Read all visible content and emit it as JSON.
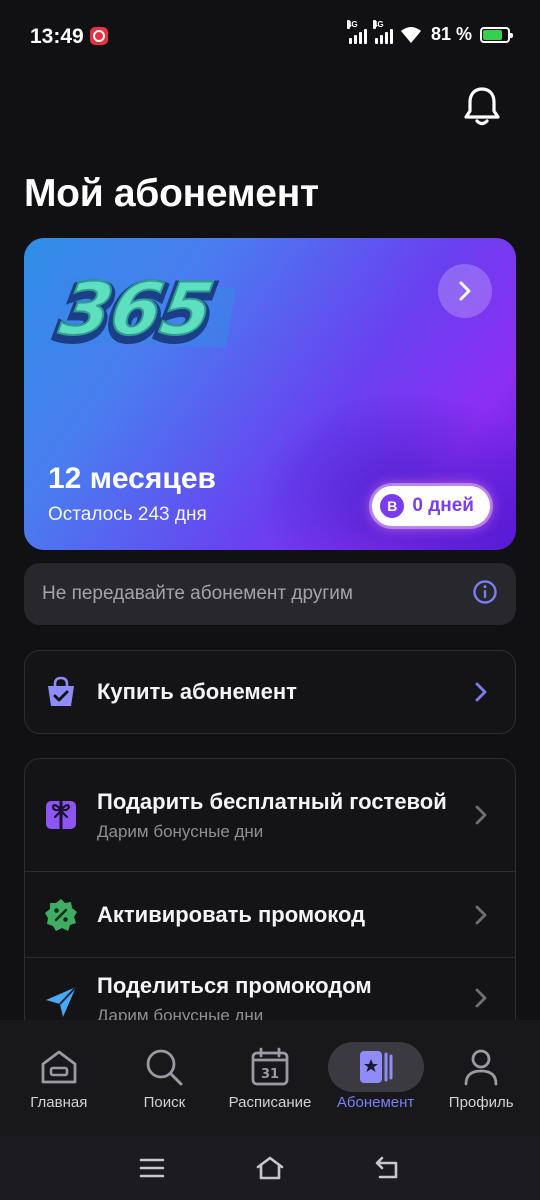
{
  "status_bar": {
    "time": "13:49",
    "network_1": "4G",
    "network_2": "4G",
    "battery_percent": "81 %",
    "battery_level": 0.81
  },
  "header": {
    "title": "Мой абонемент"
  },
  "subscription_card": {
    "logo_text": "365",
    "duration": "12 месяцев",
    "remaining": "Осталось 243 дня",
    "bonus_badge_letter": "B",
    "bonus_badge_text": "0 дней"
  },
  "notice": {
    "text": "Не передавайте абонемент другим"
  },
  "menu": {
    "buy": {
      "title": "Купить абонемент"
    },
    "gift": {
      "title": "Подарить бесплатный гостевой",
      "subtitle": "Дарим бонусные дни"
    },
    "activate_promo": {
      "title": "Активировать промокод"
    },
    "share_promo": {
      "title": "Поделиться промокодом",
      "subtitle": "Дарим бонусные дни"
    }
  },
  "bottom_nav": {
    "items": [
      {
        "label": "Главная",
        "icon": "home-icon"
      },
      {
        "label": "Поиск",
        "icon": "search-icon"
      },
      {
        "label": "Расписание",
        "icon": "calendar-icon",
        "calendar_day": "31"
      },
      {
        "label": "Абонемент",
        "icon": "membership-icon"
      },
      {
        "label": "Профиль",
        "icon": "profile-icon"
      }
    ],
    "active_index": 3
  },
  "colors": {
    "background": "#111113",
    "accent": "#7d7cf6",
    "bonus": "#7b3cf0",
    "promo_green": "#3fae63",
    "gift_purple": "#8e56f0",
    "share_blue": "#4aa9f4"
  }
}
